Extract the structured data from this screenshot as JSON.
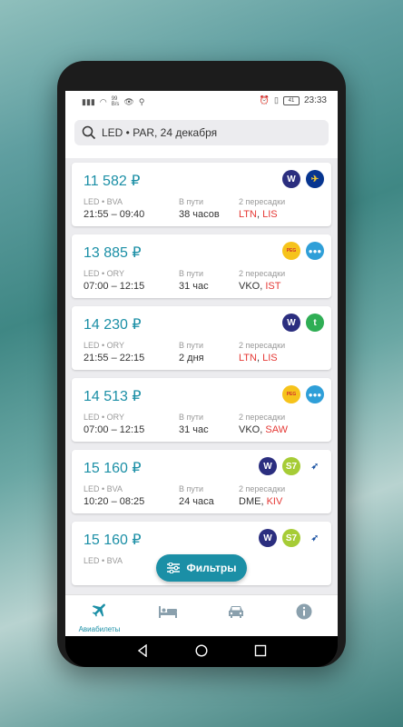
{
  "status": {
    "net_speed": "99\nB/s",
    "battery": "41",
    "time": "23:33"
  },
  "search": {
    "query": "LED • PAR, 24 декабря"
  },
  "labels": {
    "in_transit": "В пути"
  },
  "flights": [
    {
      "price": "11 582 ₽",
      "route": "LED • BVA",
      "times": "21:55 – 09:40",
      "duration": "38 часов",
      "stops_label": "2 пересадки",
      "stop1": "LTN",
      "stop1_red": true,
      "stop2": "LIS",
      "stop2_red": true,
      "logos": [
        "wizzair-logo",
        "ryanair-logo"
      ]
    },
    {
      "price": "13 885 ₽",
      "route": "LED • ORY",
      "times": "07:00 – 12:15",
      "duration": "31 час",
      "stops_label": "2 пересадки",
      "stop1": "VKO",
      "stop1_red": false,
      "stop2": "IST",
      "stop2_red": true,
      "logos": [
        "pegasus-logo",
        "dots-logo"
      ]
    },
    {
      "price": "14 230 ₽",
      "route": "LED • ORY",
      "times": "21:55 – 22:15",
      "duration": "2 дня",
      "stops_label": "2 пересадки",
      "stop1": "LTN",
      "stop1_red": true,
      "stop2": "LIS",
      "stop2_red": true,
      "logos": [
        "wizzair-logo",
        "transavia-logo"
      ]
    },
    {
      "price": "14 513 ₽",
      "route": "LED • ORY",
      "times": "07:00 – 12:15",
      "duration": "31 час",
      "stops_label": "2 пересадки",
      "stop1": "VKO",
      "stop1_red": false,
      "stop2": "SAW",
      "stop2_red": true,
      "logos": [
        "pegasus-logo",
        "dots-logo"
      ]
    },
    {
      "price": "15 160 ₽",
      "route": "LED • BVA",
      "times": "10:20 – 08:25",
      "duration": "24 часа",
      "stops_label": "2 пересадки",
      "stop1": "DME",
      "stop1_red": false,
      "stop2": "KIV",
      "stop2_red": true,
      "logos": [
        "wizzair-logo",
        "s7-logo",
        "airmoldova-logo"
      ]
    },
    {
      "price": "15 160 ₽",
      "route": "LED • BVA",
      "times": "",
      "duration": "",
      "stops_label": "",
      "stop1": "",
      "stop1_red": false,
      "stop2": "",
      "stop2_red": false,
      "logos": [
        "wizzair-logo",
        "s7-logo",
        "airmoldova-logo"
      ]
    }
  ],
  "filter_button": {
    "label": "Фильтры"
  },
  "nav": [
    {
      "label": "Авиабилеты",
      "icon": "plane-icon"
    },
    {
      "label": "",
      "icon": "bed-icon"
    },
    {
      "label": "",
      "icon": "car-icon"
    },
    {
      "label": "",
      "icon": "info-icon"
    }
  ],
  "colors": {
    "accent": "#1b8fa6",
    "red": "#e53935"
  }
}
